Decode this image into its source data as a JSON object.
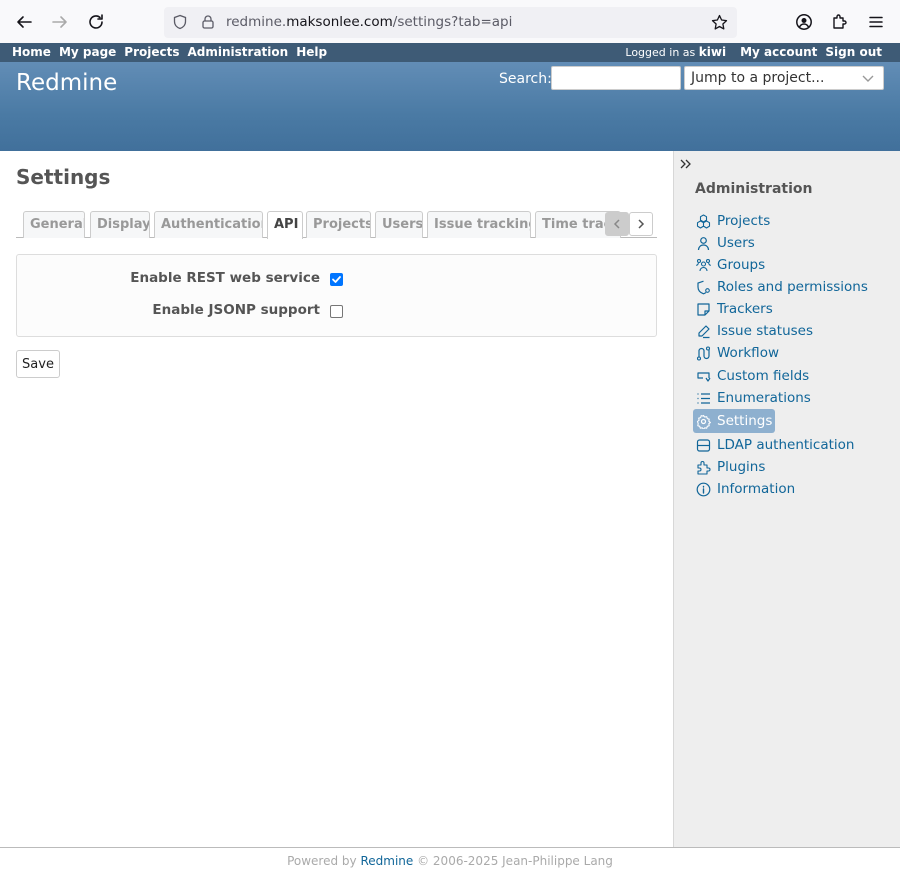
{
  "browser": {
    "url_prefix": "redmine.",
    "url_domain": "maksonlee.com",
    "url_path": "/settings?tab=api"
  },
  "top_menu": {
    "left": [
      "Home",
      "My page",
      "Projects",
      "Administration",
      "Help"
    ],
    "logged_in_as": "Logged in as",
    "user": "kiwi",
    "my_account": "My account",
    "sign_out": "Sign out"
  },
  "header": {
    "title": "Redmine",
    "search_label": "Search:",
    "search_value": "",
    "jump_placeholder": "Jump to a project..."
  },
  "main": {
    "title": "Settings",
    "tabs": [
      "General",
      "Display",
      "Authentication",
      "API",
      "Projects",
      "Users",
      "Issue tracking",
      "Time tracking"
    ],
    "selected_tab": "API",
    "settings": [
      {
        "label": "Enable REST web service",
        "checked": true
      },
      {
        "label": "Enable JSONP support",
        "checked": false
      }
    ],
    "save_label": "Save"
  },
  "sidebar": {
    "title": "Administration",
    "items": [
      {
        "label": "Projects",
        "icon": "projects-icon"
      },
      {
        "label": "Users",
        "icon": "user-icon"
      },
      {
        "label": "Groups",
        "icon": "group-icon"
      },
      {
        "label": "Roles and permissions",
        "icon": "shield-icon"
      },
      {
        "label": "Trackers",
        "icon": "sticky-note-icon"
      },
      {
        "label": "Issue statuses",
        "icon": "edit-icon"
      },
      {
        "label": "Workflow",
        "icon": "workflow-icon"
      },
      {
        "label": "Custom fields",
        "icon": "custom-field-icon"
      },
      {
        "label": "Enumerations",
        "icon": "list-icon"
      },
      {
        "label": "Settings",
        "icon": "gear-icon",
        "selected": true
      },
      {
        "label": "LDAP authentication",
        "icon": "server-icon"
      },
      {
        "label": "Plugins",
        "icon": "puzzle-icon"
      },
      {
        "label": "Information",
        "icon": "info-icon"
      }
    ]
  },
  "footer": {
    "prefix": "Powered by",
    "link": "Redmine",
    "suffix": "© 2006-2025 Jean-Philippe Lang"
  },
  "colors": {
    "top_menu_bg": "#3e5b76",
    "header_bg": "#628db6",
    "link": "#116699",
    "sidebar_bg": "#eeeeee",
    "selected_item_bg": "#8eb0cf",
    "checkbox_checked": "#0075ff"
  }
}
